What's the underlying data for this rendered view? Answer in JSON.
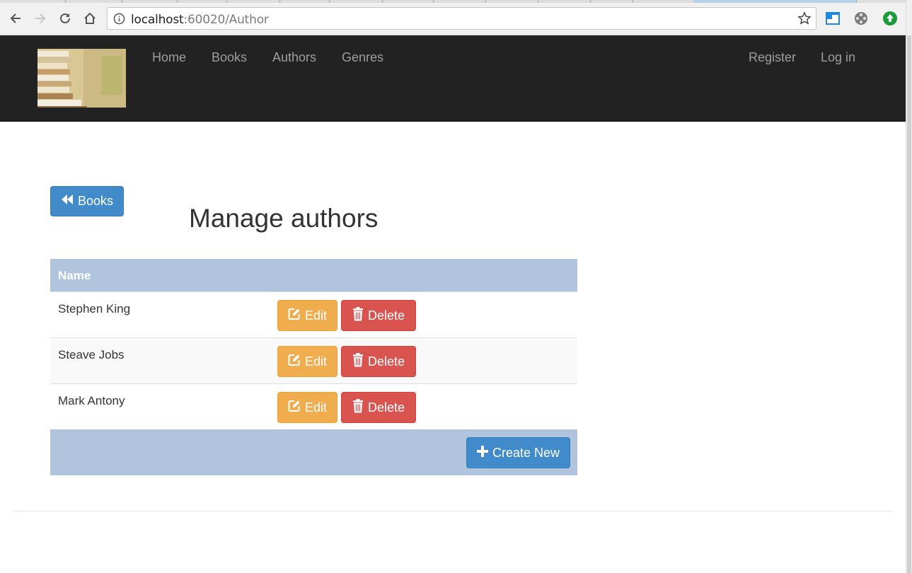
{
  "browser": {
    "url_host": "localhost",
    "url_rest": ":60020/Author",
    "icons": [
      "back-icon",
      "forward-icon",
      "reload-icon",
      "home-icon",
      "info-icon",
      "star-icon"
    ]
  },
  "nav": {
    "brand_logo": "books-logo",
    "left_links": [
      {
        "label": "Home"
      },
      {
        "label": "Books"
      },
      {
        "label": "Authors"
      },
      {
        "label": "Genres"
      }
    ],
    "right_links": [
      {
        "label": "Register"
      },
      {
        "label": "Log in"
      }
    ]
  },
  "page": {
    "back_button": "Books",
    "title": "Manage authors",
    "table": {
      "header_name": "Name",
      "rows": [
        {
          "name": "Stephen King",
          "edit": "Edit",
          "delete": "Delete"
        },
        {
          "name": "Steave Jobs",
          "edit": "Edit",
          "delete": "Delete"
        },
        {
          "name": "Mark Antony",
          "edit": "Edit",
          "delete": "Delete"
        }
      ],
      "create_button": "Create New"
    }
  },
  "colors": {
    "navbar": "#222222",
    "grid_header": "#b0c4de",
    "primary": "#428bca",
    "warning": "#f0ad4e",
    "danger": "#d9534f"
  }
}
